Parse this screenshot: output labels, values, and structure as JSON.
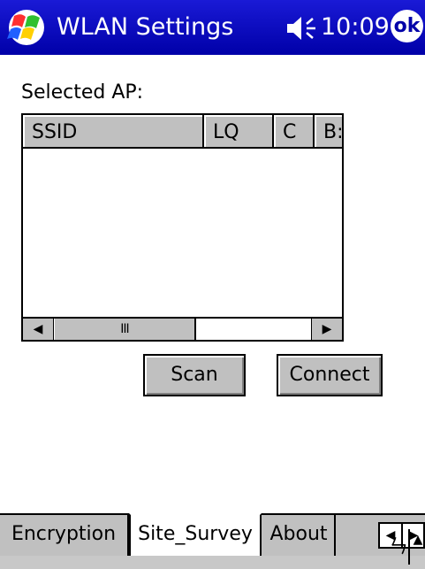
{
  "titlebar": {
    "title": "WLAN Settings",
    "time": "10:09",
    "ok_label": "ok",
    "start_icon": "windows-flag-icon",
    "speaker_icon": "speaker-icon"
  },
  "main": {
    "selected_label": "Selected AP:",
    "columns": [
      "SSID",
      "LQ",
      "C",
      "B:"
    ],
    "scroll_thumb_glyph": "III",
    "scan_label": "Scan",
    "connect_label": "Connect"
  },
  "tabs": {
    "items": [
      "Encryption",
      "Site_Survey",
      "About"
    ],
    "active": "Site_Survey"
  },
  "colors": {
    "titlebar": "#0000a8",
    "face": "#c0c0c0"
  }
}
